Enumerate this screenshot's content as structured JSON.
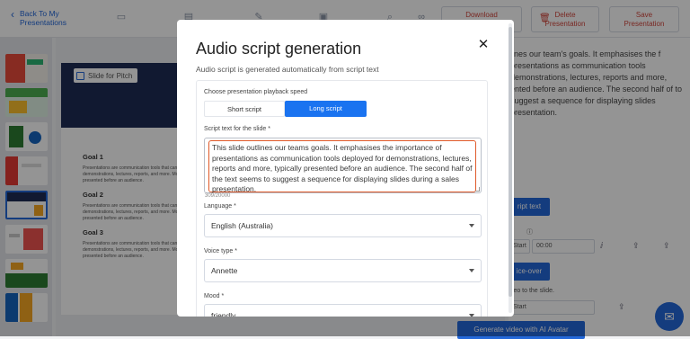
{
  "header": {
    "back_label_line1": "Back To My",
    "back_label_line2": "Presentations",
    "download_line1": "Download",
    "download_line2": "",
    "delete_line1": "Delete",
    "delete_line2": "Presentation",
    "save_line1": "Save",
    "save_line2": "Presentation"
  },
  "slide": {
    "chip_label": "Slide for Pitch",
    "goals": [
      {
        "title": "Goal 1",
        "text": "Presentations are communication tools that can be used as demonstrations, lectures, reports, and more. Most of the time, they're presented before an audience."
      },
      {
        "title": "Goal 2",
        "text": "Presentations are communication tools that can be used as demonstrations, lectures, reports, and more. Most of the time, they're presented before an audience."
      },
      {
        "title": "Goal 3",
        "text": "Presentations are communication tools that can be used as demonstrations, lectures, reports, and more. Most of the time, they're presented before an audience."
      }
    ]
  },
  "right_panel": {
    "text": "lines our team's goals. It emphasises the f presentations as communication tools demonstrations, lectures, reports and more, ented before an audience. The second half of to suggest a sequence for displaying slides presentation.",
    "script_button": "ript text",
    "start_label": "Start",
    "time_value": "00:00",
    "voice_button": "ice-over",
    "video_label": "ideo to the slide.",
    "start_label_2": "Start",
    "generate_video": "Generate video with AI Avatar"
  },
  "modal": {
    "title": "Audio script generation",
    "subtitle": "Audio script is generated automatically from script text",
    "speed_label": "Choose presentation playback speed",
    "short_script": "Short script",
    "long_script": "Long script",
    "script_label": "Script text for the slide *",
    "script_text": "This slide outlines our teams goals. It emphasises the importance of presentations as communication tools deployed for demonstrations, lectures, reports and more, typically presented before an audience. The second half of the text seems to suggest a sequence for displaying slides during a sales presentation.",
    "counter": "309/20000",
    "language_label": "Language *",
    "language_value": "English (Australia)",
    "voice_label": "Voice type *",
    "voice_value": "Annette",
    "mood_label": "Mood *",
    "mood_value": "friendly"
  },
  "colors": {
    "accent": "#1a73f0",
    "highlight": "#e05a2a",
    "danger": "#d1453b"
  }
}
